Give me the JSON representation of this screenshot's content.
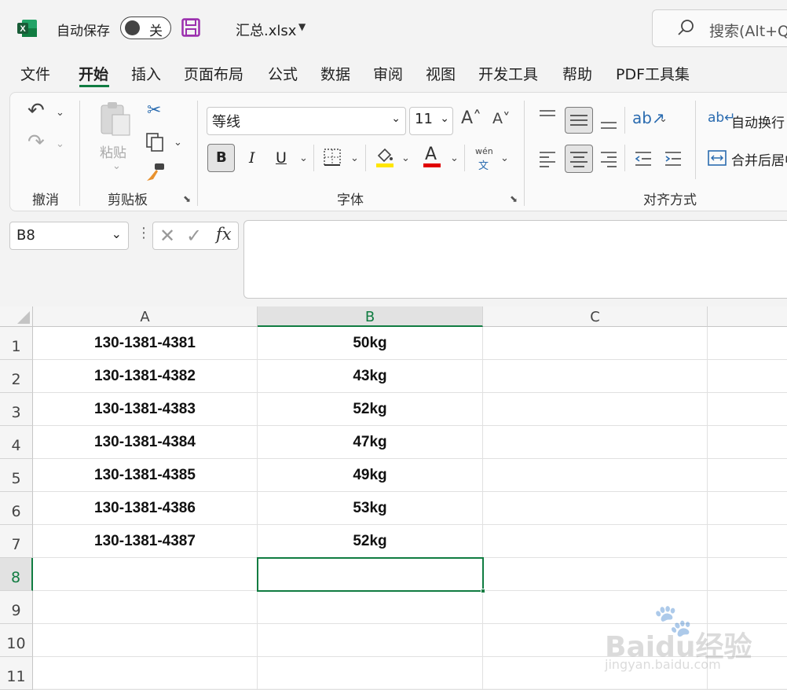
{
  "titlebar": {
    "autosave_label": "自动保存",
    "autosave_state": "关",
    "filename": "汇总.xlsx",
    "search_placeholder": "搜索(Alt+Q)",
    "app_icon": "excel-icon",
    "save_icon": "save-icon"
  },
  "menu": {
    "tabs": [
      "文件",
      "开始",
      "插入",
      "页面布局",
      "公式",
      "数据",
      "审阅",
      "视图",
      "开发工具",
      "帮助",
      "PDF工具集"
    ],
    "active": "开始"
  },
  "ribbon": {
    "groups": {
      "undo": "撤消",
      "clipboard": "剪贴板",
      "font": "字体",
      "align": "对齐方式"
    },
    "paste_label": "粘贴",
    "font_name": "等线",
    "font_size": "11",
    "bold": "B",
    "italic": "I",
    "underline": "U",
    "phonetic_top": "wén",
    "phonetic_bottom": "文",
    "wrap_text": "自动换行",
    "merge_center": "合并后居中",
    "fill_color": "#ffe600",
    "font_color": "#e00000"
  },
  "formula_bar": {
    "name_box": "B8",
    "fx": "fx",
    "content": ""
  },
  "sheet": {
    "columns": [
      "A",
      "B",
      "C"
    ],
    "selected_cell": "B8",
    "rows": [
      {
        "n": "1",
        "a": "130-1381-4381",
        "b": "50kg"
      },
      {
        "n": "2",
        "a": "130-1381-4382",
        "b": "43kg"
      },
      {
        "n": "3",
        "a": "130-1381-4383",
        "b": "52kg"
      },
      {
        "n": "4",
        "a": "130-1381-4384",
        "b": "47kg"
      },
      {
        "n": "5",
        "a": "130-1381-4385",
        "b": "49kg"
      },
      {
        "n": "6",
        "a": "130-1381-4386",
        "b": "53kg"
      },
      {
        "n": "7",
        "a": "130-1381-4387",
        "b": "52kg"
      },
      {
        "n": "8",
        "a": "",
        "b": ""
      },
      {
        "n": "9",
        "a": "",
        "b": ""
      },
      {
        "n": "10",
        "a": "",
        "b": ""
      },
      {
        "n": "11",
        "a": "",
        "b": ""
      }
    ]
  },
  "watermark": {
    "brand": "Baidu经验",
    "url": "jingyan.baidu.com"
  }
}
